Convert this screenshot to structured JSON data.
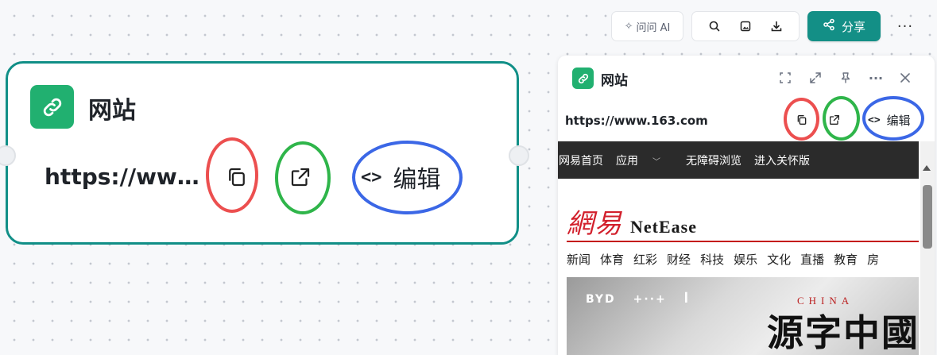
{
  "toolbar": {
    "ask_ai_label": "问问 AI",
    "share_label": "分享",
    "more_label": "···"
  },
  "node": {
    "title": "网站",
    "url": "https://www.163.com",
    "edit_label": "编辑",
    "edit_code": "<>"
  },
  "panel": {
    "title": "网站",
    "url": "https://www.163.com",
    "edit_label": "编辑",
    "edit_code": "<>",
    "more_label": "···"
  },
  "site": {
    "nav": [
      "网易首页",
      "应用",
      "无障碍浏览",
      "进入关怀版"
    ],
    "logo_cn": "網易",
    "logo_en": "NetEase",
    "channels": [
      "新闻",
      "体育",
      "红彩",
      "财经",
      "科技",
      "娱乐",
      "文化",
      "直播",
      "教育",
      "房"
    ],
    "banner_logos": [
      "BYD",
      "+··+",
      "ꟾ"
    ],
    "banner_en": "CHINA",
    "banner_cn": "源字中國"
  },
  "colors": {
    "accent": "#138f86",
    "node_border": "#118f87",
    "icon_green": "#21b070",
    "ring_red": "#ec4f4f",
    "ring_green": "#2fb54a",
    "ring_blue": "#3b67e6"
  }
}
